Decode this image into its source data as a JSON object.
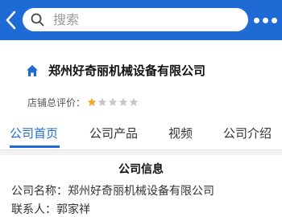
{
  "header": {
    "search_placeholder": "搜索",
    "accent_color": "#1f6bd6",
    "icons": [
      "back-arrow-icon",
      "search-icon",
      "more-dots-icon"
    ]
  },
  "store": {
    "name": "郑州好奇丽机械设备有限公司",
    "rating_label": "店铺总评价：",
    "rating_stars": 1,
    "rating_max": 5,
    "icon": "home-icon"
  },
  "tabs": [
    {
      "label": "公司首页",
      "active": true
    },
    {
      "label": "公司产品",
      "active": false
    },
    {
      "label": "视频",
      "active": false
    },
    {
      "label": "公司介绍",
      "active": false
    }
  ],
  "info": {
    "title": "公司信息",
    "rows": [
      {
        "label": "公司名称：",
        "value": "郑州好奇丽机械设备有限公司"
      },
      {
        "label": "联系人：",
        "value": "郭家祥"
      }
    ]
  }
}
